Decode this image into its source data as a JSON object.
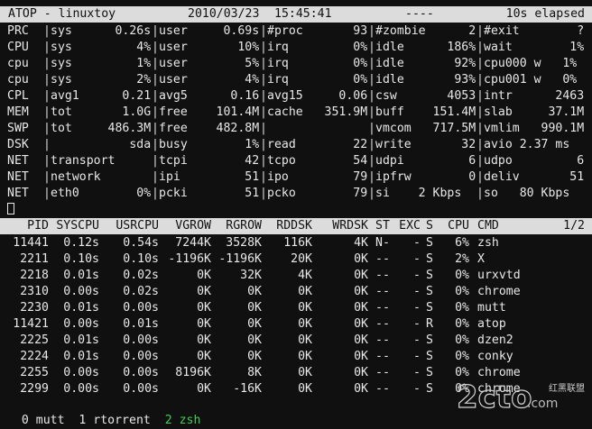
{
  "header": {
    "title": "ATOP - linuxtoy",
    "date": "2010/03/23",
    "time": "15:45:41",
    "dashes": "----",
    "elapsed": "10s elapsed"
  },
  "sys_rows": [
    [
      "PRC",
      "sys      0.26s",
      "user     0.69s",
      "#proc       93",
      "#zombie      2",
      "#exit        ?"
    ],
    [
      "CPU",
      "sys         4%",
      "user       10%",
      "irq         0%",
      "idle      186%",
      "wait        1%"
    ],
    [
      "cpu",
      "sys         1%",
      "user        5%",
      "irq         0%",
      "idle       92%",
      "cpu000 w   1%"
    ],
    [
      "cpu",
      "sys         2%",
      "user        4%",
      "irq         0%",
      "idle       93%",
      "cpu001 w   0%"
    ],
    [
      "CPL",
      "avg1      0.21",
      "avg5      0.16",
      "avg15     0.06",
      "csw       4053",
      "intr      2463"
    ],
    [
      "MEM",
      "tot       1.0G",
      "free    101.4M",
      "cache   351.9M",
      "buff    151.4M",
      "slab     37.1M"
    ],
    [
      "SWP",
      "tot     486.3M",
      "free    482.8M",
      "",
      "vmcom   717.5M",
      "vmlim   990.1M"
    ],
    [
      "DSK",
      "           sda",
      "busy        1%",
      "read        22",
      "write       32",
      "avio 2.37 ms"
    ],
    [
      "NET",
      "transport",
      "tcpi        42",
      "tcpo        54",
      "udpi         6",
      "udpo         6"
    ],
    [
      "NET",
      "network",
      "ipi         51",
      "ipo         79",
      "ipfrw        0",
      "deliv       51"
    ],
    [
      "NET",
      "eth0        0%",
      "pcki        51",
      "pcko        79",
      "si    2 Kbps",
      "so   80 Kbps"
    ]
  ],
  "proc_header": {
    "cols": [
      "PID",
      "SYSCPU",
      "USRCPU",
      "VGROW",
      "RGROW",
      "RDDSK",
      "WRDSK",
      "ST",
      "EXC",
      "S",
      "CPU",
      "CMD"
    ],
    "page": "1/2"
  },
  "procs": [
    [
      "11441",
      "0.12s",
      "0.54s",
      "7244K",
      "3528K",
      "116K",
      "4K",
      "N-",
      "-",
      "S",
      "6%",
      "zsh"
    ],
    [
      "2211",
      "0.10s",
      "0.10s",
      "-1196K",
      "-1196K",
      "20K",
      "0K",
      "--",
      "-",
      "S",
      "2%",
      "X"
    ],
    [
      "2218",
      "0.01s",
      "0.02s",
      "0K",
      "32K",
      "4K",
      "0K",
      "--",
      "-",
      "S",
      "0%",
      "urxvtd"
    ],
    [
      "2310",
      "0.00s",
      "0.02s",
      "0K",
      "0K",
      "0K",
      "0K",
      "--",
      "-",
      "S",
      "0%",
      "chrome"
    ],
    [
      "2230",
      "0.01s",
      "0.00s",
      "0K",
      "0K",
      "0K",
      "0K",
      "--",
      "-",
      "S",
      "0%",
      "mutt"
    ],
    [
      "11421",
      "0.00s",
      "0.01s",
      "0K",
      "0K",
      "0K",
      "0K",
      "--",
      "-",
      "R",
      "0%",
      "atop"
    ],
    [
      "2225",
      "0.01s",
      "0.00s",
      "0K",
      "0K",
      "0K",
      "0K",
      "--",
      "-",
      "S",
      "0%",
      "dzen2"
    ],
    [
      "2224",
      "0.01s",
      "0.00s",
      "0K",
      "0K",
      "0K",
      "0K",
      "--",
      "-",
      "S",
      "0%",
      "conky"
    ],
    [
      "2255",
      "0.00s",
      "0.00s",
      "8196K",
      "8K",
      "0K",
      "0K",
      "--",
      "-",
      "S",
      "0%",
      "chrome"
    ],
    [
      "2299",
      "0.00s",
      "0.00s",
      "0K",
      "-16K",
      "0K",
      "0K",
      "--",
      "-",
      "S",
      "0%",
      "chrome"
    ]
  ],
  "tmux_bar": {
    "win0": "0 mutt",
    "win1": "1 rtorrent",
    "win2": "2 zsh"
  },
  "watermark": {
    "text": "2cto",
    "suffix": ".com",
    "cn": "红黑联盟"
  },
  "colors": {
    "background": "#101010",
    "foreground": "#e8e8e8",
    "bar": "#dcdcdc",
    "active_window": "#44cc55"
  }
}
